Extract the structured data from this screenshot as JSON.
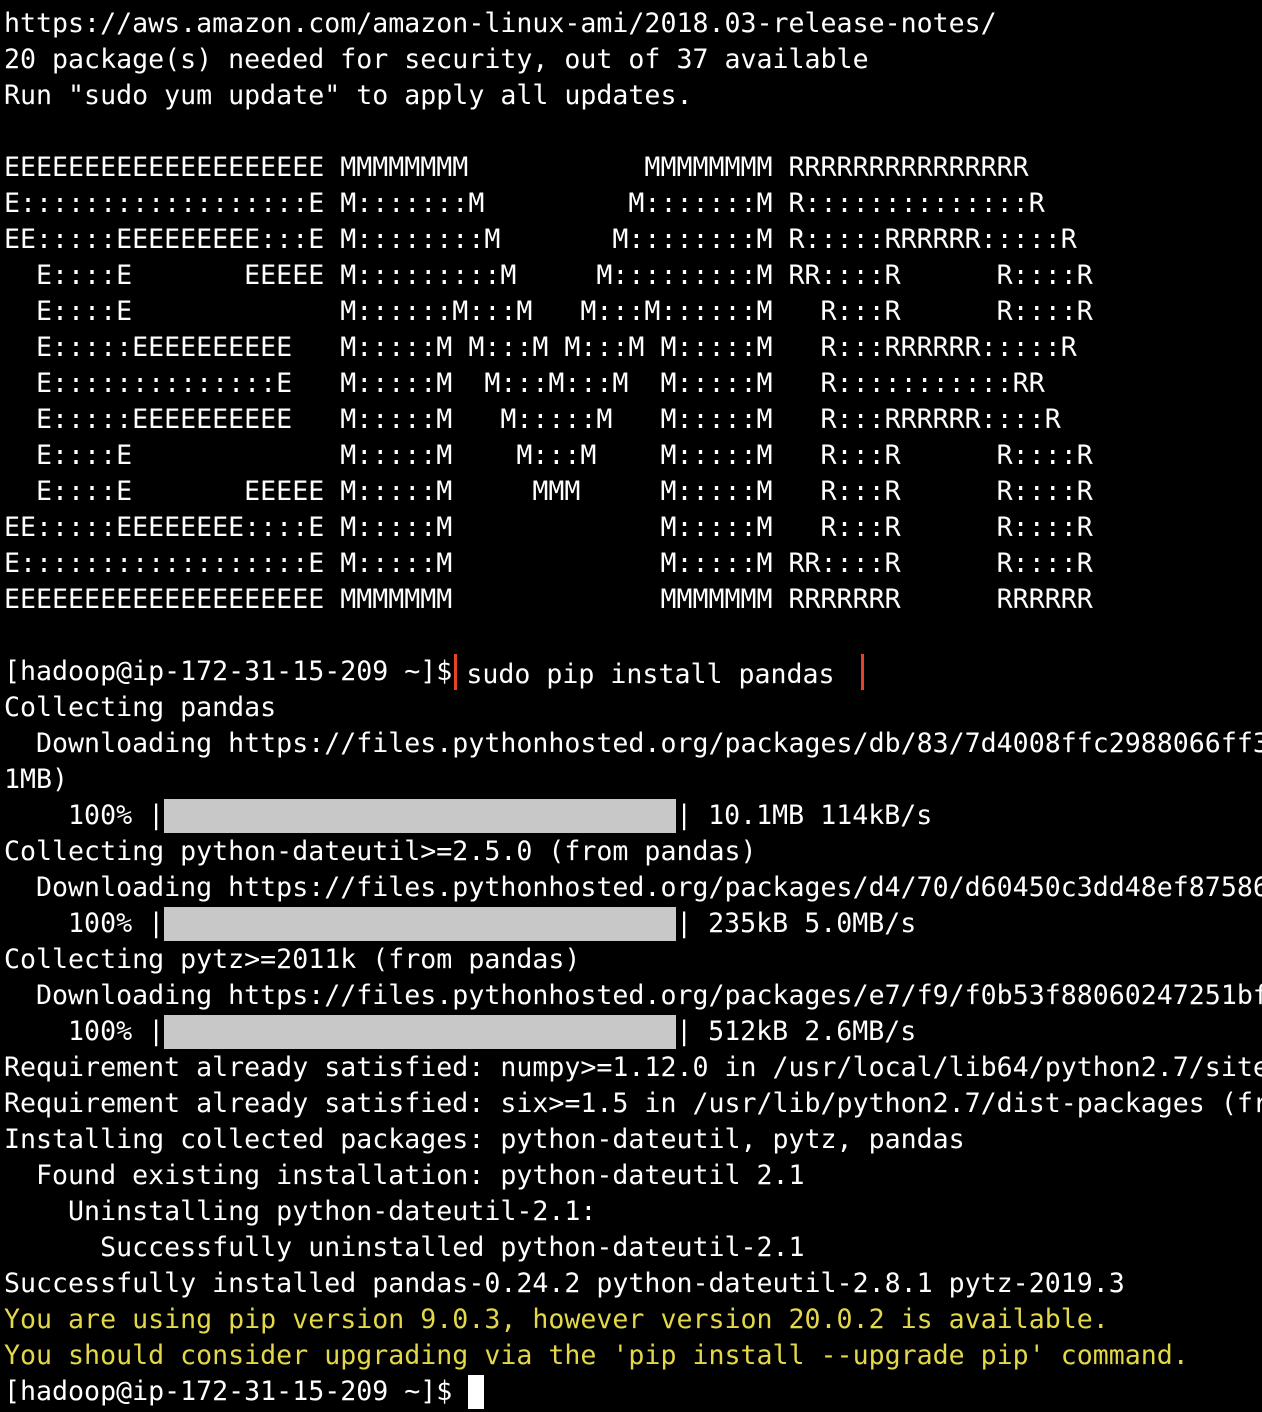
{
  "motd": [
    "https://aws.amazon.com/amazon-linux-ami/2018.03-release-notes/",
    "20 package(s) needed for security, out of 37 available",
    "Run \"sudo yum update\" to apply all updates."
  ],
  "banner": [
    "EEEEEEEEEEEEEEEEEEEE MMMMMMMM           MMMMMMMM RRRRRRRRRRRRRRR",
    "E::::::::::::::::::E M:::::::M         M:::::::M R::::::::::::::R",
    "EE:::::EEEEEEEEE:::E M::::::::M       M::::::::M R:::::RRRRRR:::::R",
    "  E::::E       EEEEE M:::::::::M     M:::::::::M RR::::R      R::::R",
    "  E::::E             M::::::M:::M   M:::M::::::M   R:::R      R::::R",
    "  E:::::EEEEEEEEEE   M:::::M M:::M M:::M M:::::M   R:::RRRRRR:::::R",
    "  E::::::::::::::E   M:::::M  M:::M:::M  M:::::M   R:::::::::::RR",
    "  E:::::EEEEEEEEEE   M:::::M   M:::::M   M:::::M   R:::RRRRRR::::R",
    "  E::::E             M:::::M    M:::M    M:::::M   R:::R      R::::R",
    "  E::::E       EEEEE M:::::M     MMM     M:::::M   R:::R      R::::R",
    "EE:::::EEEEEEEE::::E M:::::M             M:::::M   R:::R      R::::R",
    "E::::::::::::::::::E M:::::M             M:::::M RR::::R      R::::R",
    "EEEEEEEEEEEEEEEEEEEE MMMMMMM             MMMMMMM RRRRRRR      RRRRRR"
  ],
  "prompt": "[hadoop@ip-172-31-15-209 ~]$",
  "command": "sudo pip install pandas",
  "output": {
    "collect_pandas": "Collecting pandas",
    "dl_pandas": "  Downloading https://files.pythonhosted.org/packages/db/83/7d4008ffc2988066ff3",
    "dl_pandas_cont": "1MB)",
    "bar_prefix": "    100% |",
    "progress_1": {
      "stats": "| 10.1MB 114kB/s",
      "percent": 100
    },
    "collect_dateutil": "Collecting python-dateutil>=2.5.0 (from pandas)",
    "dl_dateutil": "  Downloading https://files.pythonhosted.org/packages/d4/70/d60450c3dd48ef87586",
    "progress_2": {
      "stats": "| 235kB 5.0MB/s",
      "percent": 100
    },
    "collect_pytz": "Collecting pytz>=2011k (from pandas)",
    "dl_pytz": "  Downloading https://files.pythonhosted.org/packages/e7/f9/f0b53f88060247251bf",
    "progress_3": {
      "stats": "| 512kB 2.6MB/s",
      "percent": 100
    },
    "req_numpy": "Requirement already satisfied: numpy>=1.12.0 in /usr/local/lib64/python2.7/site",
    "req_six": "Requirement already satisfied: six>=1.5 in /usr/lib/python2.7/dist-packages (fr",
    "installing": "Installing collected packages: python-dateutil, pytz, pandas",
    "found_existing": "  Found existing installation: python-dateutil 2.1",
    "uninstalling": "    Uninstalling python-dateutil-2.1:",
    "uninstalled": "      Successfully uninstalled python-dateutil-2.1",
    "installed": "Successfully installed pandas-0.24.2 python-dateutil-2.8.1 pytz-2019.3"
  },
  "warnings": {
    "line1": "You are using pip version 9.0.3, however version 20.0.2 is available.",
    "line2": "You should consider upgrading via the 'pip install --upgrade pip' command."
  },
  "colors": {
    "background": "#000000",
    "text": "#ffffff",
    "warning": "#e3d84a",
    "highlight_box": "#e8412c",
    "progress_fill": "#c8c8c8"
  }
}
